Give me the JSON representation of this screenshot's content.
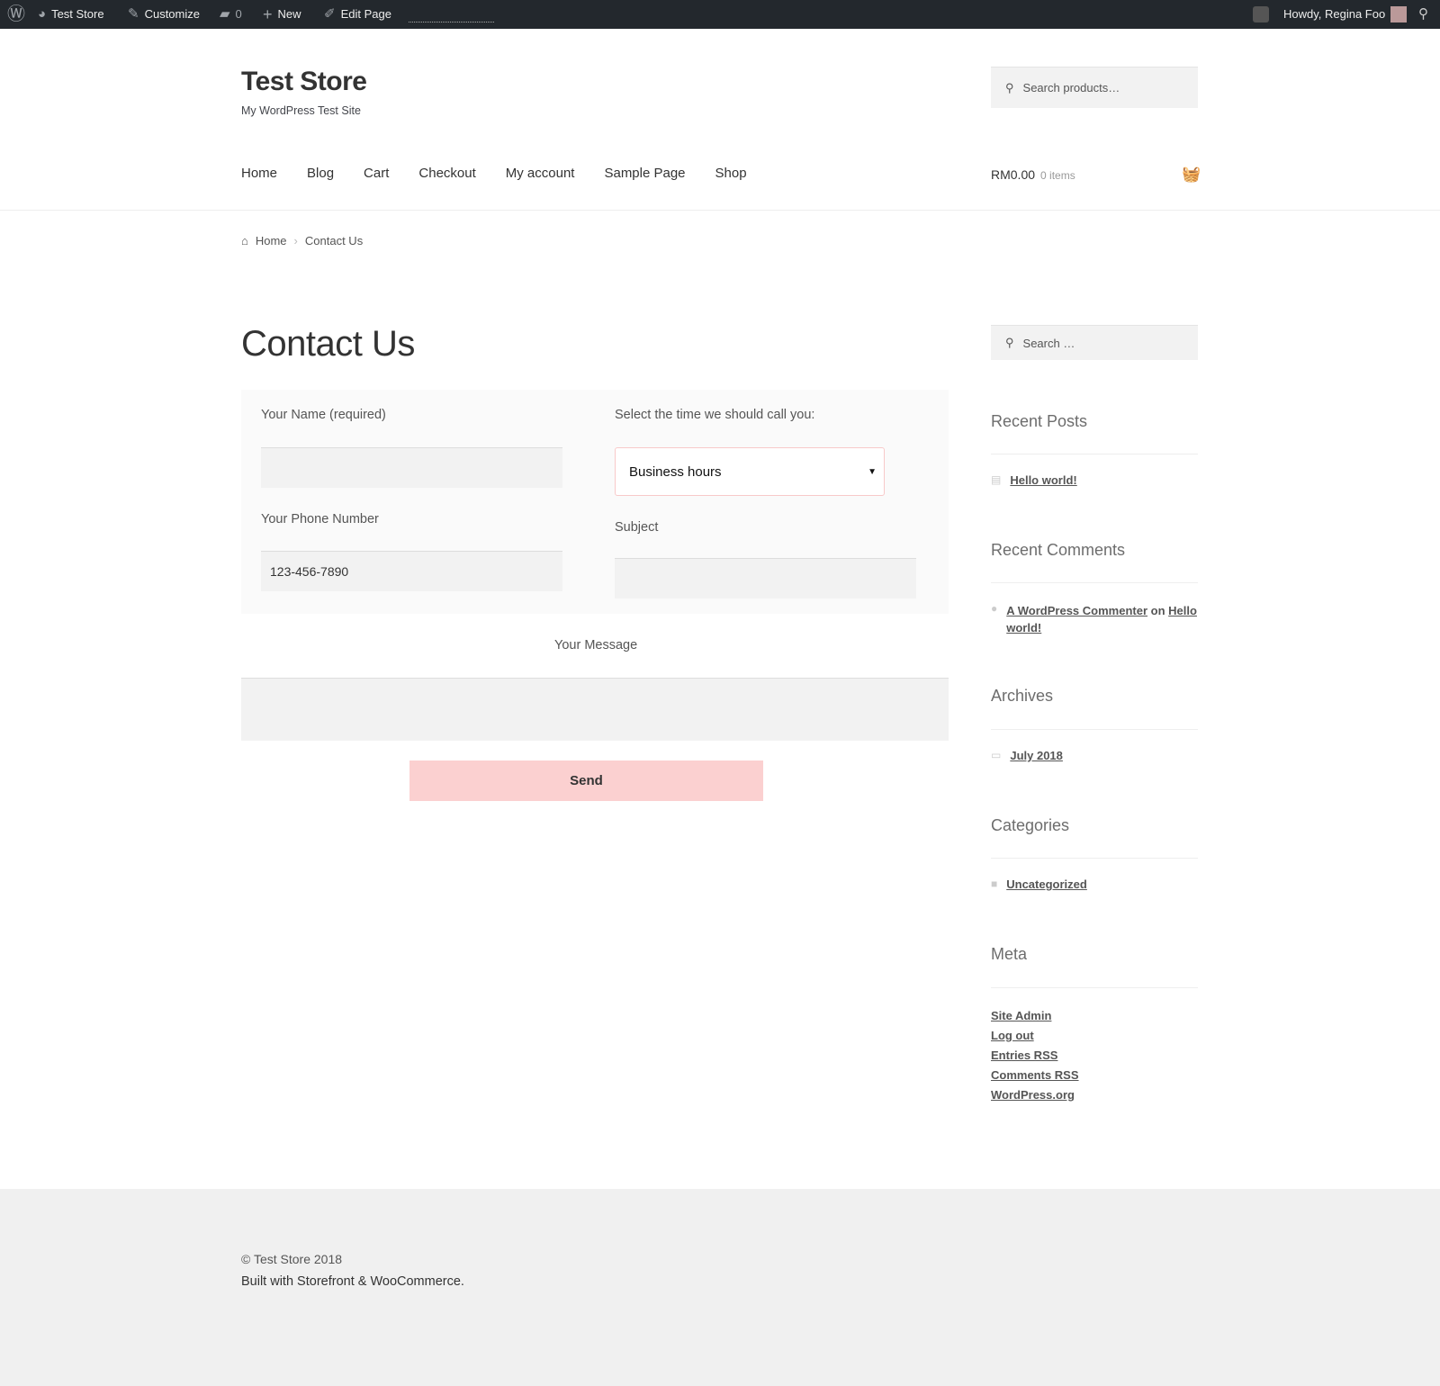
{
  "admin_bar": {
    "site": "Test Store",
    "customize": "Customize",
    "comments": "0",
    "new": "New",
    "edit": "Edit Page",
    "howdy": "Howdy, Regina Foo"
  },
  "header": {
    "title": "Test Store",
    "tagline": "My WordPress Test Site",
    "search_placeholder": "Search products…",
    "nav": [
      "Home",
      "Blog",
      "Cart",
      "Checkout",
      "My account",
      "Sample Page",
      "Shop"
    ],
    "cart_total": "RM0.00",
    "cart_items": "0 items"
  },
  "breadcrumb": {
    "home": "Home",
    "current": "Contact Us"
  },
  "page": {
    "title": "Contact Us",
    "form": {
      "name_label": "Your Name (required)",
      "phone_label": "Your Phone Number",
      "phone_value": "123-456-7890",
      "time_label": "Select the time we should call you:",
      "time_value": "Business hours",
      "subject_label": "Subject",
      "message_label": "Your Message",
      "send": "Send"
    }
  },
  "sidebar": {
    "search_placeholder": "Search …",
    "recent_posts": {
      "title": "Recent Posts",
      "items": [
        "Hello world!"
      ]
    },
    "recent_comments": {
      "title": "Recent Comments",
      "author": "A WordPress Commenter",
      "on": "on",
      "post": "Hello world!"
    },
    "archives": {
      "title": "Archives",
      "items": [
        "July 2018"
      ]
    },
    "categories": {
      "title": "Categories",
      "items": [
        "Uncategorized"
      ]
    },
    "meta": {
      "title": "Meta",
      "items": [
        "Site Admin",
        "Log out",
        "Entries RSS",
        "Comments RSS",
        "WordPress.org"
      ]
    }
  },
  "footer": {
    "copyright": "© Test Store 2018",
    "built": "Built with Storefront & WooCommerce."
  },
  "colors": {
    "admin_bar": "#23282d",
    "send_button": "#fbd0d0",
    "footer": "#f0f0f0"
  }
}
